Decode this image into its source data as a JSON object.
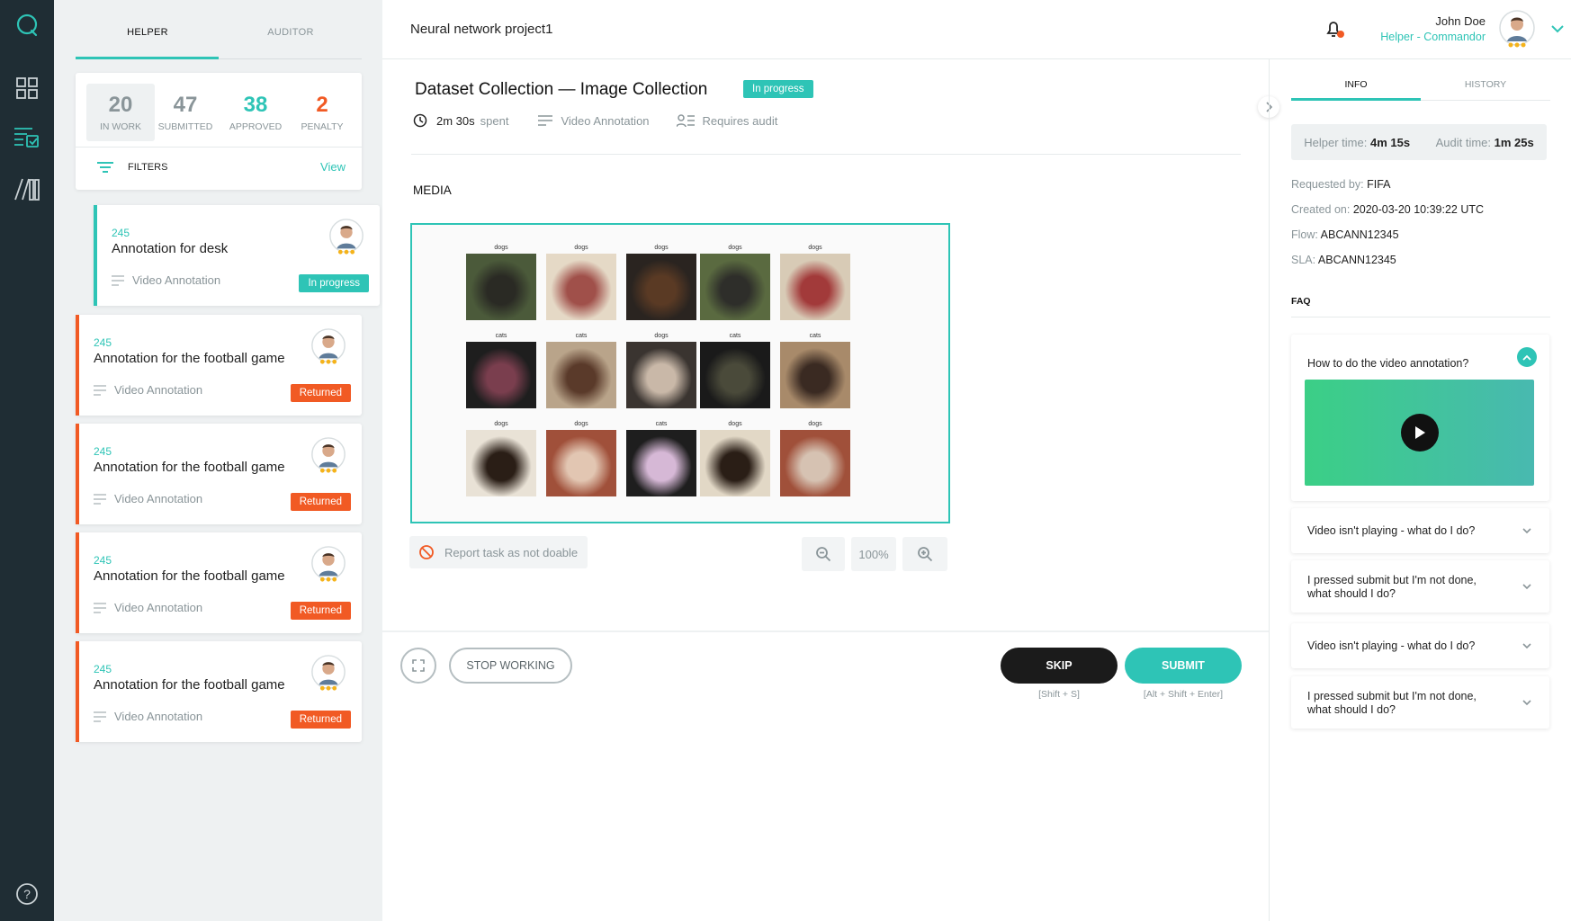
{
  "sidebar": {
    "icons": [
      "chat-logo-icon",
      "dashboard-icon",
      "tasks-checklist-icon",
      "library-icon",
      "help-icon"
    ]
  },
  "left_panel": {
    "tabs": [
      "HELPER",
      "AUDITOR"
    ],
    "stats": [
      {
        "value": "20",
        "label": "IN WORK",
        "color": "#8a9599"
      },
      {
        "value": "47",
        "label": "SUBMITTED",
        "color": "#8a9599"
      },
      {
        "value": "38",
        "label": "APPROVED",
        "color": "#2ec4b6"
      },
      {
        "value": "2",
        "label": "PENALTY",
        "color": "#f15a24"
      }
    ],
    "filters_label": "FILTERS",
    "view_label": "View",
    "tasks": [
      {
        "id": "245",
        "title": "Annotation for desk",
        "type": "Video Annotation",
        "status": "In progress"
      },
      {
        "id": "245",
        "title": "Annotation for the football game",
        "type": "Video Annotation",
        "status": "Returned"
      },
      {
        "id": "245",
        "title": "Annotation for the football game",
        "type": "Video Annotation",
        "status": "Returned"
      },
      {
        "id": "245",
        "title": "Annotation for the football game",
        "type": "Video Annotation",
        "status": "Returned"
      },
      {
        "id": "245",
        "title": "Annotation for the football game",
        "type": "Video Annotation",
        "status": "Returned"
      }
    ]
  },
  "header": {
    "project_title": "Neural network project1",
    "user_name": "John Doe",
    "user_role": "Helper - Commandor"
  },
  "task_detail": {
    "title": "Dataset Collection — Image Collection",
    "status": "In progress",
    "time_value": "2m 30s",
    "time_suffix": "spent",
    "type": "Video Annotation",
    "audit": "Requires audit",
    "media_label": "MEDIA",
    "grid_captions": [
      "dogs",
      "dogs",
      "dogs",
      "dogs",
      "dogs",
      "cats",
      "cats",
      "dogs",
      "cats",
      "cats",
      "dogs",
      "dogs",
      "cats",
      "dogs",
      "dogs"
    ],
    "report_label": "Report task as not doable",
    "zoom_level": "100%",
    "stop_label": "STOP WORKING",
    "skip_label": "SKIP",
    "skip_hint": "[Shift + S]",
    "submit_label": "SUBMIT",
    "submit_hint": "[Alt + Shift + Enter]"
  },
  "info_panel": {
    "tabs": [
      "INFO",
      "HISTORY"
    ],
    "helper_time_label": "Helper time:",
    "helper_time_value": "4m 15s",
    "audit_time_label": "Audit time:",
    "audit_time_value": "1m 25s",
    "requested_by_label": "Requested by:",
    "requested_by_value": "FIFA",
    "created_on_label": "Created on:",
    "created_on_value": "2020-03-20 10:39:22 UTC",
    "flow_label": "Flow:",
    "flow_value": "ABCANN12345",
    "sla_label": "SLA:",
    "sla_value": "ABCANN12345",
    "faq_label": "FAQ",
    "faqs": [
      {
        "q": "How to do the video annotation?"
      },
      {
        "q": "Video isn't playing - what do I do?"
      },
      {
        "q": "I pressed submit but I'm not done, what should I do?"
      },
      {
        "q": "Video isn't playing - what do I do?"
      },
      {
        "q": "I pressed submit but I'm not done, what should I do?"
      }
    ]
  },
  "colors": {
    "accent": "#2ec4b6",
    "danger": "#f15a24",
    "dark": "#1f2d34"
  }
}
